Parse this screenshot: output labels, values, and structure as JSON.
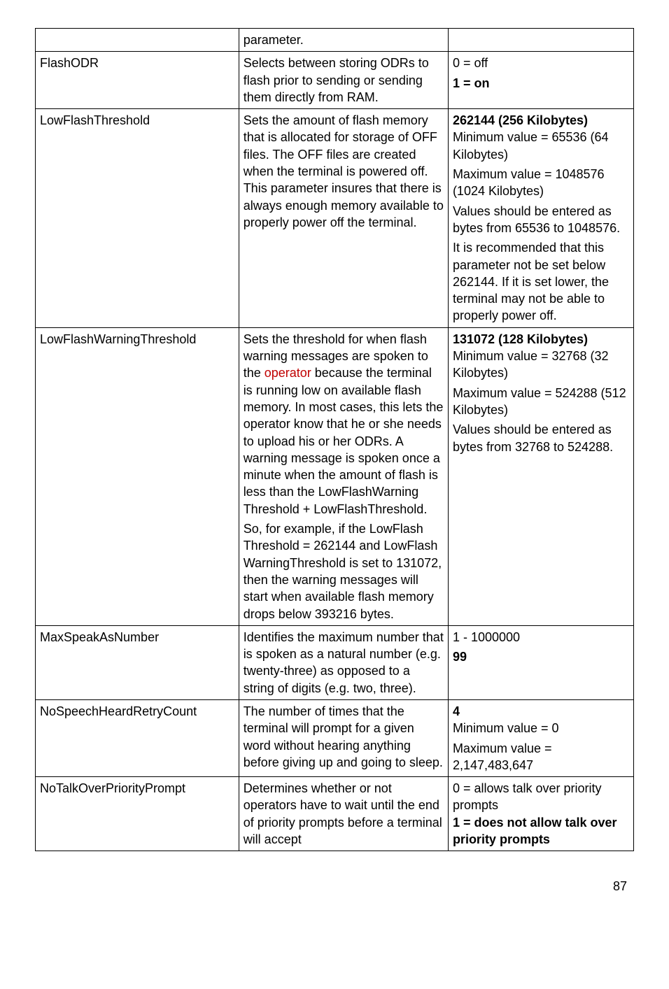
{
  "rows": [
    {
      "name": "",
      "desc": [
        {
          "t": "parameter."
        }
      ],
      "val": [
        {
          "t": ""
        }
      ]
    },
    {
      "name": "FlashODR",
      "desc": [
        {
          "t": "Selects between storing ODRs to flash prior to sending or sending them directly from RAM."
        }
      ],
      "val": [
        {
          "t": "0 = off"
        },
        {
          "t": " 1 = on",
          "bold": true
        }
      ]
    },
    {
      "name": "LowFlashThreshold",
      "desc": [
        {
          "t": "Sets the amount of flash memory that is allocated for storage of OFF files. The OFF files are created when the terminal is powered off. This parameter insures that there is always enough memory available to properly power off the terminal."
        }
      ],
      "val": [
        {
          "mixed": [
            {
              "t": "262144 (256 Kilobytes)",
              "bold": true
            },
            {
              "t": " Minimum value = 65536 (64 Kilobytes)"
            }
          ]
        },
        {
          "t": "Maximum value = 1048576 (1024 Kilobytes)"
        },
        {
          "t": "Values should be entered as bytes from 65536 to 1048576."
        },
        {
          "t": "It is recommended that this parameter not be set below 262144. If it is set lower, the terminal may not be able to properly power off."
        }
      ]
    },
    {
      "name": "LowFlashWarningThreshold",
      "desc": [
        {
          "mixed": [
            {
              "t": "Sets the threshold for when flash warning messages are spoken to the "
            },
            {
              "t": "operator",
              "link": true
            },
            {
              "t": " because the terminal is running low on available flash memory. In most cases, this lets the operator know that he or she needs to upload his or her ODRs. A warning message is spoken once a minute when the amount of flash is less than the LowFlashWarning Threshold + LowFlashThreshold."
            }
          ]
        },
        {
          "t": "So, for example, if the LowFlash Threshold = 262144 and LowFlash WarningThreshold is set to 131072, then the warning messages will start when available flash memory drops below 393216 bytes."
        }
      ],
      "val": [
        {
          "mixed": [
            {
              "t": "131072 (128 Kilobytes)",
              "bold": true
            },
            {
              "t": " Minimum value = 32768 (32 Kilobytes)"
            }
          ]
        },
        {
          "t": "Maximum value = 524288 (512 Kilobytes)"
        },
        {
          "t": "Values should be entered as bytes from 32768 to 524288."
        }
      ]
    },
    {
      "name": "MaxSpeakAsNumber",
      "desc": [
        {
          "t": "Identifies the maximum number that is spoken as a natural number (e.g. twenty-three) as opposed to a string of digits (e.g. two, three)."
        }
      ],
      "val": [
        {
          "t": "1 - 1000000"
        },
        {
          "t": "99",
          "bold": true
        }
      ]
    },
    {
      "name": "NoSpeechHeardRetryCount",
      "desc": [
        {
          "t": "The number of times that the terminal will prompt for a given word without hearing anything before giving up and going to sleep."
        }
      ],
      "val": [
        {
          "mixed": [
            {
              "t": "4",
              "bold": true
            },
            {
              "t": " Minimum value = 0"
            }
          ]
        },
        {
          "t": "Maximum value = 2,147,483,647"
        }
      ]
    },
    {
      "name": "NoTalkOverPriorityPrompt",
      "desc": [
        {
          "t": "Determines whether or not operators have to wait until the end of priority prompts before a terminal will accept"
        }
      ],
      "val": [
        {
          "mixed": [
            {
              "t": "0 = allows talk over priority prompts"
            },
            {
              "t": " 1 = does not allow talk over priority prompts",
              "bold": true
            }
          ]
        }
      ]
    }
  ],
  "pageNumber": "87"
}
